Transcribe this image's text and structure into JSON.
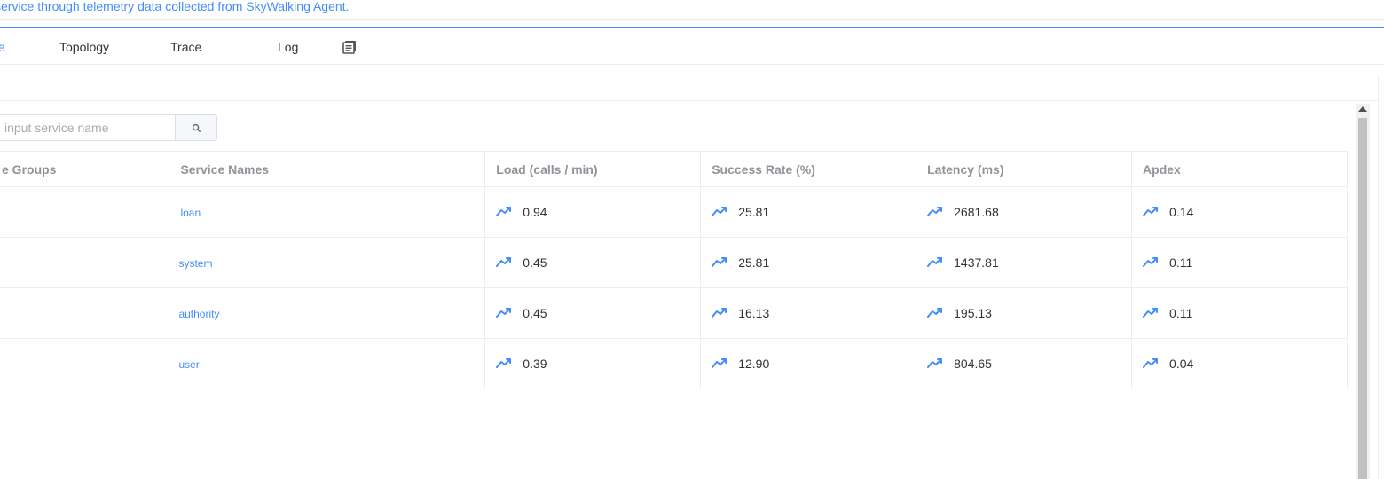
{
  "header": {
    "description": "service through telemetry data collected from SkyWalking Agent."
  },
  "tabs": [
    {
      "label": "Service",
      "visible_text": "e",
      "active": true
    },
    {
      "label": "Topology",
      "active": false
    },
    {
      "label": "Trace",
      "active": false
    },
    {
      "label": "Log",
      "active": false
    }
  ],
  "tab_extra_icon": "document-copy-icon",
  "search": {
    "placeholder": "input service name",
    "button_icon": "search-icon"
  },
  "table": {
    "headers": [
      "e Groups",
      "Service Names",
      "Load (calls / min)",
      "Success Rate (%)",
      "Latency (ms)",
      "Apdex"
    ],
    "rows": [
      {
        "group": "",
        "service": "loan",
        "load": "0.94",
        "success_rate": "25.81",
        "latency": "2681.68",
        "apdex": "0.14"
      },
      {
        "group": "",
        "service": "system",
        "load": "0.45",
        "success_rate": "25.81",
        "latency": "1437.81",
        "apdex": "0.11"
      },
      {
        "group": "",
        "service": "authority",
        "load": "0.45",
        "success_rate": "16.13",
        "latency": "195.13",
        "apdex": "0.11"
      },
      {
        "group": "",
        "service": "user",
        "load": "0.39",
        "success_rate": "12.90",
        "latency": "804.65",
        "apdex": "0.04"
      }
    ],
    "metric_icon": "trend-line-icon"
  },
  "colors": {
    "accent": "#448dfe",
    "header_text": "#909399",
    "border": "#ebeef5"
  }
}
